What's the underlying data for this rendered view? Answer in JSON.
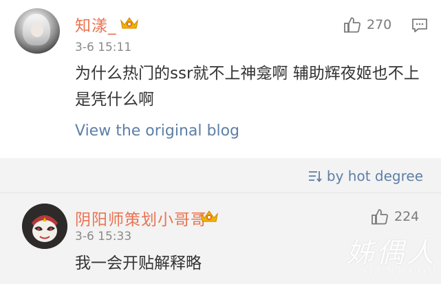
{
  "post": {
    "username": "知漾_",
    "timestamp": "3-6 15:11",
    "content": "为什么热门的ssr就不上神龛啊 辅助辉夜姬也不上是凭什么啊",
    "view_link": "View the original blog",
    "likes": "270",
    "icons": [
      "avatar",
      "vip-crown-icon",
      "thumb-up-icon",
      "comment-icon"
    ]
  },
  "sort": {
    "label": "by hot degree",
    "icon": "sort-icon"
  },
  "comment": {
    "username": "阴阳师策划小哥哥",
    "timestamp": "3-6 15:33",
    "content": "我一会开贴解释略",
    "likes": "224",
    "icons": [
      "avatar",
      "vip-crown-icon",
      "thumb-up-icon"
    ]
  },
  "watermark": {
    "line1": "姊偶人",
    "line2": "94.I.N.R.COM"
  },
  "colors": {
    "username": "#eb7350",
    "link": "#5d7fa6",
    "text": "#333333",
    "meta": "#8a8a8a",
    "section_bg": "#f3f3f3"
  }
}
